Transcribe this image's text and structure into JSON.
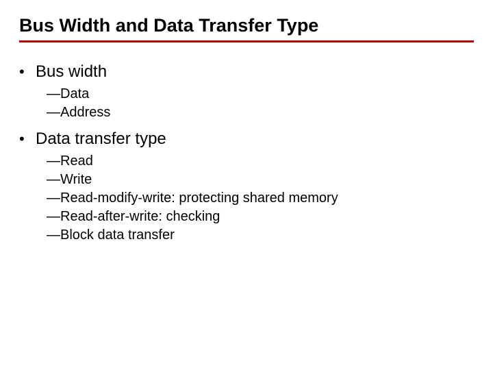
{
  "title": "Bus Width and Data Transfer Type",
  "sections": [
    {
      "heading": "Bus width",
      "items": [
        "Data",
        "Address"
      ]
    },
    {
      "heading": "Data transfer type",
      "items": [
        "Read",
        "Write",
        "Read-modify-write: protecting shared memory",
        "Read-after-write: checking",
        "Block data transfer"
      ]
    }
  ],
  "bullets": {
    "l1": "•",
    "l2": "—"
  }
}
